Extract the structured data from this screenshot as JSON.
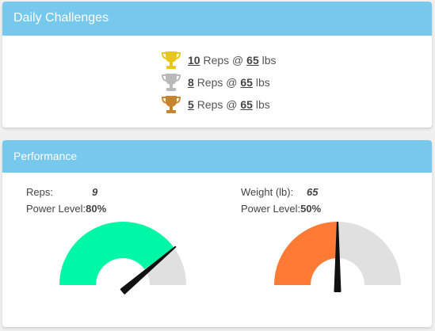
{
  "daily": {
    "title": "Daily Challenges",
    "challenges": [
      {
        "medal": "gold",
        "color": "#e8c620",
        "icon": "trophy-icon",
        "reps": "10",
        "reps_label": "Reps @",
        "weight": "65",
        "unit": "lbs"
      },
      {
        "medal": "silver",
        "color": "#b9b9b9",
        "icon": "trophy-icon",
        "reps": "8",
        "reps_label": "Reps @",
        "weight": "65",
        "unit": "lbs"
      },
      {
        "medal": "bronze",
        "color": "#c8832f",
        "icon": "trophy-icon",
        "reps": "5",
        "reps_label": "Reps @",
        "weight": "65",
        "unit": "lbs"
      }
    ]
  },
  "performance": {
    "title": "Performance",
    "reps": {
      "label": "Reps:",
      "value": "9",
      "power_label": "Power Level:",
      "power_value": "80%",
      "level": 0.8,
      "color": "#00f7a6",
      "track_color": "#e0e0e0",
      "needle_color": "#111111"
    },
    "weight": {
      "label": "Weight (lb):",
      "value": "65",
      "power_label": "Power Level:",
      "power_value": "50%",
      "level": 0.5,
      "color": "#ff7a35",
      "track_color": "#e0e0e0",
      "needle_color": "#111111"
    }
  }
}
